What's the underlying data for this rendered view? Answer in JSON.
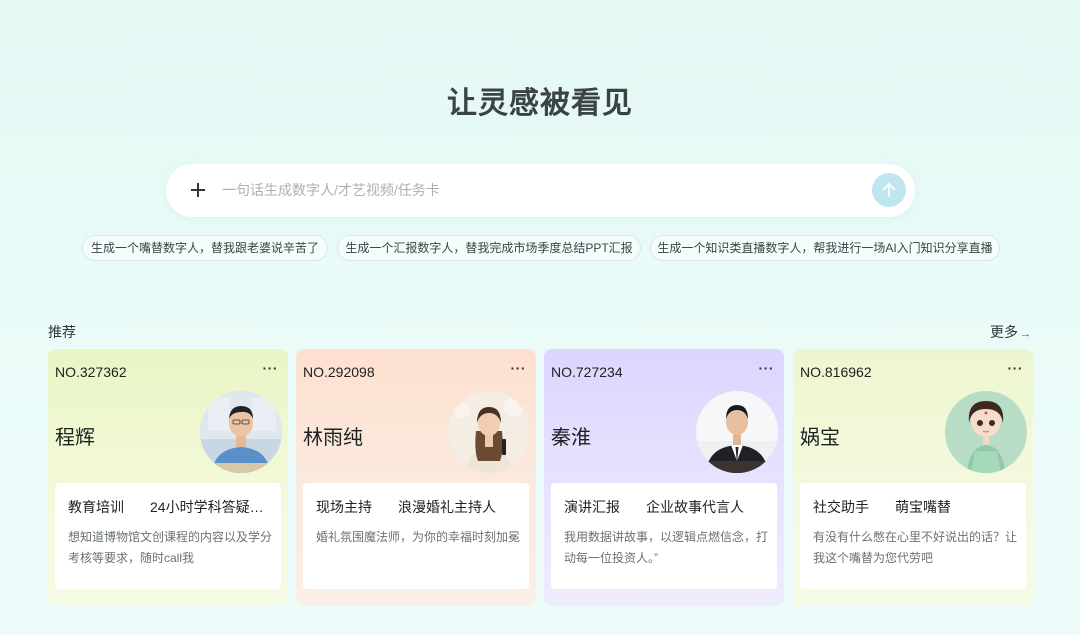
{
  "hero": {
    "title": "让灵感被看见"
  },
  "search": {
    "placeholder": "一句话生成数字人/才艺视频/任务卡",
    "value": ""
  },
  "suggestions": [
    "生成一个嘴替数字人，替我跟老婆说辛苦了",
    "生成一个汇报数字人，替我完成市场季度总结PPT汇报",
    "生成一个知识类直播数字人，帮我进行一场AI入门知识分享直播"
  ],
  "recommend": {
    "label": "推荐",
    "more_label": "更多"
  },
  "cards": [
    {
      "number": "NO.327362",
      "name": "程辉",
      "tag1": "教育培训",
      "tag2": "24小时学科答疑…",
      "desc": "想知道博物馆文创课程的内容以及学分考核等要求，随时call我"
    },
    {
      "number": "NO.292098",
      "name": "林雨纯",
      "tag1": "现场主持",
      "tag2": "浪漫婚礼主持人",
      "desc": "婚礼氛围魔法师，为你的幸福时刻加冕"
    },
    {
      "number": "NO.727234",
      "name": "秦淮",
      "tag1": "演讲汇报",
      "tag2": "企业故事代言人",
      "desc": "我用数据讲故事，以逻辑点燃信念，打动每一位投资人。”"
    },
    {
      "number": "NO.816962",
      "name": "娲宝",
      "tag1": "社交助手",
      "tag2": "萌宝嘴替",
      "desc": "有没有什么憋在心里不好说出的话？让我这个嘴替为您代劳吧"
    }
  ],
  "icons": {
    "add": "plus-icon",
    "send": "arrow-up-icon",
    "more": "ellipsis-icon",
    "more_link": "arrow-right-icon"
  },
  "colors": {
    "background": "#e6f9f5",
    "send_button": "#bfe6ee",
    "card1": "#e9f5c5",
    "card2": "#fde0cf",
    "card3": "#dcd5ff",
    "card4": "#eef6cf"
  }
}
